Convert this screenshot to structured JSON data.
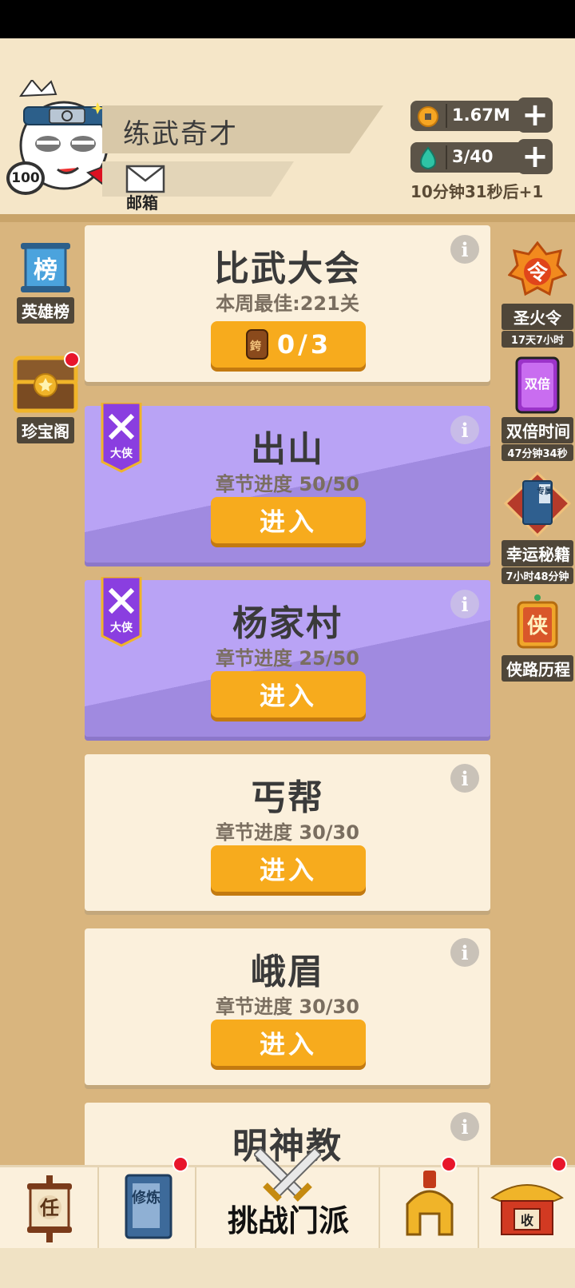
{
  "player": {
    "name": "练武奇才",
    "level": "100",
    "mail_label": "邮箱"
  },
  "resources": {
    "coins": "1.67M",
    "energy": "3/40",
    "energy_timer": "10分钟31秒后+1"
  },
  "left_sidebar": [
    {
      "label": "英雄榜",
      "icon_text": "榜"
    },
    {
      "label": "珍宝阁"
    }
  ],
  "right_sidebar": [
    {
      "label": "圣火令",
      "sub": "17天7小时",
      "icon_text": "令"
    },
    {
      "label": "双倍时间",
      "sub": "47分钟34秒",
      "icon_text": "双倍"
    },
    {
      "label": "幸运秘籍",
      "sub": "7小时48分钟",
      "icon_text": "专属"
    },
    {
      "label": "侠路历程",
      "icon_text": "侠"
    }
  ],
  "tournament": {
    "title": "比武大会",
    "best": "本周最佳:221关",
    "tickets": "0/3",
    "ticket_icon_text": "銙"
  },
  "sects": [
    {
      "title": "出山",
      "progress": "章节进度 50/50",
      "button": "进入",
      "rank": "大侠"
    },
    {
      "title": "杨家村",
      "progress": "章节进度 25/50",
      "button": "进入",
      "rank": "大侠"
    },
    {
      "title": "丐帮",
      "progress": "章节进度 30/30",
      "button": "进入"
    },
    {
      "title": "峨眉",
      "progress": "章节进度 30/30",
      "button": "进入"
    },
    {
      "title": "明神教"
    }
  ],
  "bottom_nav": {
    "tasks_icon_text": "任",
    "train_icon_text": "修炼",
    "challenge_label": "挑战门派",
    "collect_icon_text": "收"
  },
  "colors": {
    "accent_orange": "#f7ab1d",
    "purple_card": "#b9a3f5",
    "badge_red": "#e8152b"
  }
}
